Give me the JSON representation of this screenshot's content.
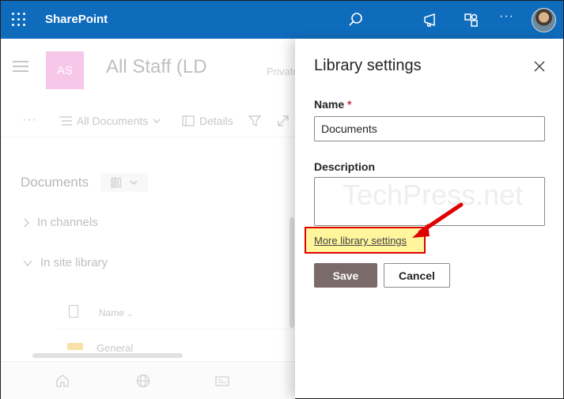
{
  "topbar": {
    "app_name": "SharePoint",
    "icons": [
      "waffle-icon",
      "search-icon",
      "megaphone-icon",
      "settings-icon",
      "more-icon",
      "avatar"
    ],
    "more_label": "···",
    "accent": "#0f6cbd"
  },
  "site": {
    "logo_initials": "AS",
    "logo_color": "#f09ad8",
    "title": "All Staff (LD",
    "privacy": "Private",
    "command_bar": {
      "more": "···",
      "view_label": "All Documents",
      "details_label": "Details"
    },
    "documents_label": "Documents",
    "tree": [
      {
        "label": "In channels"
      },
      {
        "label": "In site library"
      }
    ],
    "columns": {
      "name": "Name"
    },
    "rows": [
      {
        "name": "General"
      }
    ]
  },
  "panel": {
    "title": "Library settings",
    "name_label": "Name",
    "required_mark": "*",
    "name_value": "Documents",
    "description_label": "Description",
    "description_value": "",
    "watermark": "TechPress.net",
    "more_link": "More library settings",
    "save_label": "Save",
    "cancel_label": "Cancel"
  }
}
